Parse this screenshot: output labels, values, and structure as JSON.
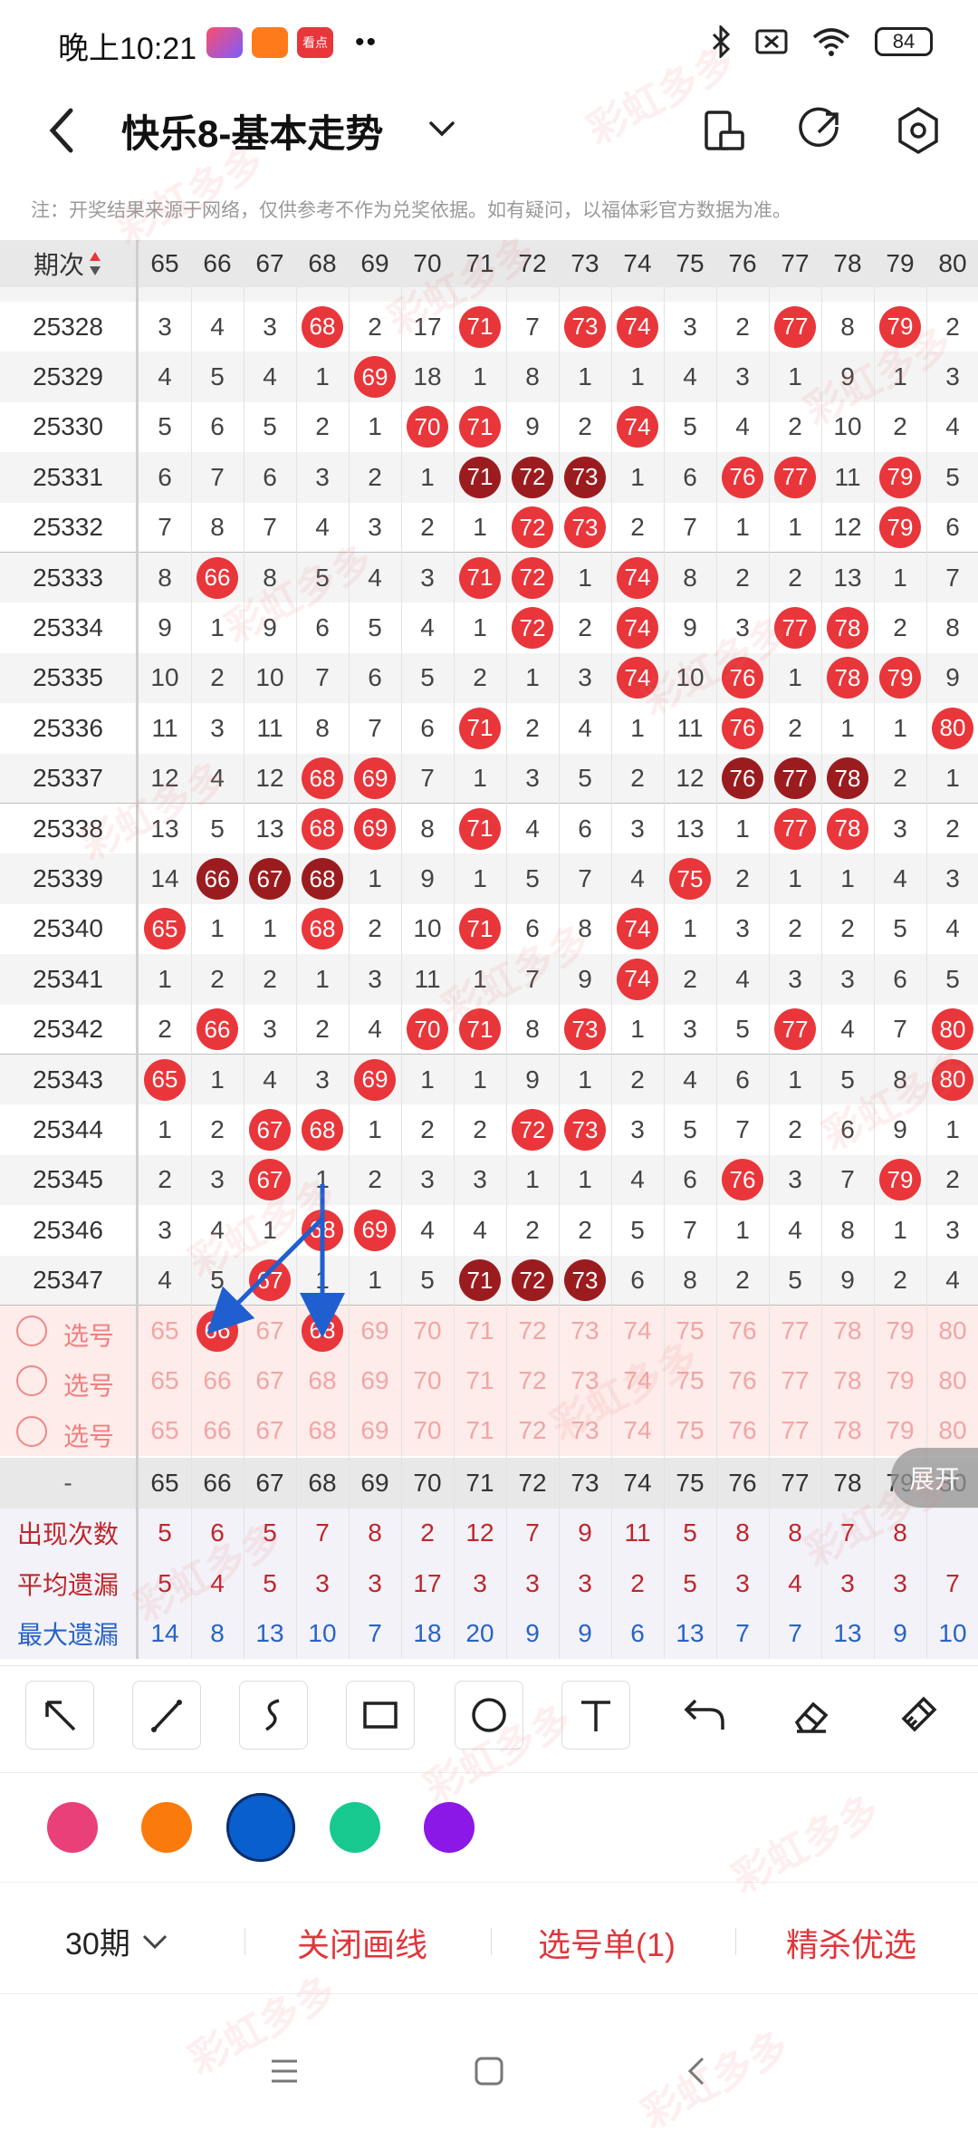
{
  "status": {
    "time": "晚上10:21",
    "battery": "84",
    "apps": [
      "",
      "",
      "看点"
    ]
  },
  "header": {
    "title": "快乐8-基本走势"
  },
  "notice": "注：开奖结果来源于网络，仅供参考不作为兑奖依据。如有疑问，以福体彩官方数据为准。",
  "table": {
    "issue_header": "期次",
    "columns": [
      "65",
      "66",
      "67",
      "68",
      "69",
      "70",
      "71",
      "72",
      "73",
      "74",
      "75",
      "76",
      "77",
      "78",
      "79",
      "80"
    ],
    "rows": [
      {
        "issue": "25328",
        "cells": [
          "3",
          "4",
          "3",
          "68",
          "2",
          "17",
          "71",
          "7",
          "73",
          "74",
          "3",
          "2",
          "77",
          "8",
          "79",
          "2"
        ]
      },
      {
        "issue": "25329",
        "cells": [
          "4",
          "5",
          "4",
          "1",
          "69",
          "18",
          "1",
          "8",
          "1",
          "1",
          "4",
          "3",
          "1",
          "9",
          "1",
          "3"
        ]
      },
      {
        "issue": "25330",
        "cells": [
          "5",
          "6",
          "5",
          "2",
          "1",
          "70",
          "71",
          "9",
          "2",
          "74",
          "5",
          "4",
          "2",
          "10",
          "2",
          "4"
        ]
      },
      {
        "issue": "25331",
        "cells": [
          "6",
          "7",
          "6",
          "3",
          "2",
          "1",
          "71",
          "72",
          "73",
          "1",
          "6",
          "76",
          "77",
          "11",
          "79",
          "5"
        ]
      },
      {
        "issue": "25332",
        "cells": [
          "7",
          "8",
          "7",
          "4",
          "3",
          "2",
          "1",
          "72",
          "73",
          "2",
          "7",
          "1",
          "1",
          "12",
          "79",
          "6"
        ]
      },
      {
        "issue": "25333",
        "cells": [
          "8",
          "66",
          "8",
          "5",
          "4",
          "3",
          "71",
          "72",
          "1",
          "74",
          "8",
          "2",
          "2",
          "13",
          "1",
          "7"
        ]
      },
      {
        "issue": "25334",
        "cells": [
          "9",
          "1",
          "9",
          "6",
          "5",
          "4",
          "1",
          "72",
          "2",
          "74",
          "9",
          "3",
          "77",
          "78",
          "2",
          "8"
        ]
      },
      {
        "issue": "25335",
        "cells": [
          "10",
          "2",
          "10",
          "7",
          "6",
          "5",
          "2",
          "1",
          "3",
          "74",
          "10",
          "76",
          "1",
          "78",
          "79",
          "9"
        ]
      },
      {
        "issue": "25336",
        "cells": [
          "11",
          "3",
          "11",
          "8",
          "7",
          "6",
          "71",
          "2",
          "4",
          "1",
          "11",
          "76",
          "2",
          "1",
          "1",
          "80"
        ]
      },
      {
        "issue": "25337",
        "cells": [
          "12",
          "4",
          "12",
          "68",
          "69",
          "7",
          "1",
          "3",
          "5",
          "2",
          "12",
          "76",
          "77",
          "78",
          "2",
          "1"
        ]
      },
      {
        "issue": "25338",
        "cells": [
          "13",
          "5",
          "13",
          "68",
          "69",
          "8",
          "71",
          "4",
          "6",
          "3",
          "13",
          "1",
          "77",
          "78",
          "3",
          "2"
        ]
      },
      {
        "issue": "25339",
        "cells": [
          "14",
          "66",
          "67",
          "68",
          "1",
          "9",
          "1",
          "5",
          "7",
          "4",
          "75",
          "2",
          "1",
          "1",
          "4",
          "3"
        ]
      },
      {
        "issue": "25340",
        "cells": [
          "65",
          "1",
          "1",
          "68",
          "2",
          "10",
          "71",
          "6",
          "8",
          "74",
          "1",
          "3",
          "2",
          "2",
          "5",
          "4"
        ]
      },
      {
        "issue": "25341",
        "cells": [
          "1",
          "2",
          "2",
          "1",
          "3",
          "11",
          "1",
          "7",
          "9",
          "74",
          "2",
          "4",
          "3",
          "3",
          "6",
          "5"
        ]
      },
      {
        "issue": "25342",
        "cells": [
          "2",
          "66",
          "3",
          "2",
          "4",
          "70",
          "71",
          "8",
          "73",
          "1",
          "3",
          "5",
          "77",
          "4",
          "7",
          "80"
        ]
      },
      {
        "issue": "25343",
        "cells": [
          "65",
          "1",
          "4",
          "3",
          "69",
          "1",
          "1",
          "9",
          "1",
          "2",
          "4",
          "6",
          "1",
          "5",
          "8",
          "80"
        ]
      },
      {
        "issue": "25344",
        "cells": [
          "1",
          "2",
          "67",
          "68",
          "1",
          "2",
          "2",
          "72",
          "73",
          "3",
          "5",
          "7",
          "2",
          "6",
          "9",
          "1"
        ]
      },
      {
        "issue": "25345",
        "cells": [
          "2",
          "3",
          "67",
          "1",
          "2",
          "3",
          "3",
          "1",
          "1",
          "4",
          "6",
          "76",
          "3",
          "7",
          "79",
          "2"
        ]
      },
      {
        "issue": "25346",
        "cells": [
          "3",
          "4",
          "1",
          "68",
          "69",
          "4",
          "4",
          "2",
          "2",
          "5",
          "7",
          "1",
          "4",
          "8",
          "1",
          "3"
        ]
      },
      {
        "issue": "25347",
        "cells": [
          "4",
          "5",
          "67",
          "1",
          "1",
          "5",
          "71",
          "72",
          "73",
          "6",
          "8",
          "2",
          "5",
          "9",
          "2",
          "4"
        ]
      }
    ],
    "repeat_marks": {
      "25331": [
        "71",
        "72",
        "73"
      ],
      "25337": [
        "76",
        "77",
        "78"
      ],
      "25339": [
        "66",
        "67",
        "68"
      ],
      "25347": [
        "71",
        "72",
        "73"
      ]
    },
    "pick_label": "选号",
    "pick_selected": {
      "row": 0,
      "cols": [
        "66",
        "68"
      ]
    }
  },
  "stats": {
    "head_label": "-",
    "rows": [
      {
        "label": "出现次数",
        "values": [
          "5",
          "6",
          "5",
          "7",
          "8",
          "2",
          "12",
          "7",
          "9",
          "11",
          "5",
          "8",
          "8",
          "7",
          "8",
          ""
        ],
        "color": "#c0262b"
      },
      {
        "label": "平均遗漏",
        "values": [
          "5",
          "4",
          "5",
          "3",
          "3",
          "17",
          "3",
          "3",
          "3",
          "2",
          "5",
          "3",
          "4",
          "3",
          "3",
          "7"
        ],
        "color": "#c0262b"
      },
      {
        "label": "最大遗漏",
        "values": [
          "14",
          "8",
          "13",
          "10",
          "7",
          "18",
          "20",
          "9",
          "9",
          "6",
          "13",
          "7",
          "7",
          "13",
          "9",
          "10"
        ],
        "color": "#2a63c4"
      }
    ],
    "expand_label": "展开"
  },
  "palette": {
    "colors": [
      "#e9407a",
      "#fb7a0c",
      "#0a5fcf",
      "#18c98f",
      "#8b18e6"
    ],
    "selected": 2
  },
  "actions": {
    "period": "30期",
    "close_draw": "关闭画线",
    "pick_list": "选号单(1)",
    "elite": "精杀优选"
  },
  "watermark_text": "彩虹多多"
}
